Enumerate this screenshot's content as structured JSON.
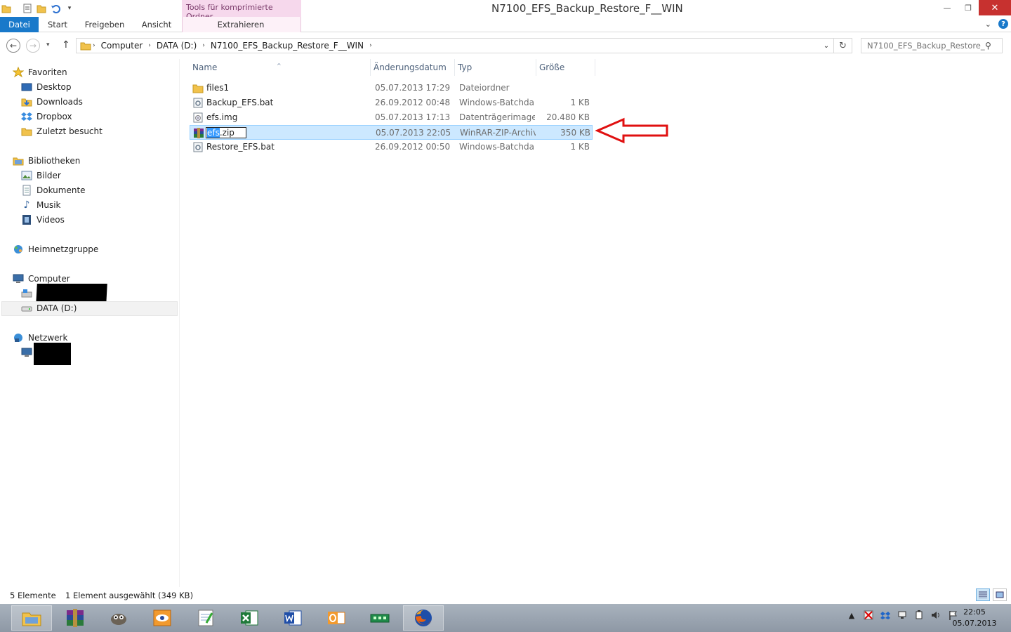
{
  "window": {
    "title": "N7100_EFS_Backup_Restore_F__WIN",
    "context_tab_header": "Tools für komprimierte Ordner",
    "controls": {
      "minimize": "—",
      "restore": "❐",
      "close": "✕"
    }
  },
  "ribbon": {
    "tabs": [
      "Datei",
      "Start",
      "Freigeben",
      "Ansicht",
      "Extrahieren"
    ]
  },
  "address": {
    "breadcrumbs": [
      "Computer",
      "DATA (D:)",
      "N7100_EFS_Backup_Restore_F__WIN"
    ],
    "search_placeholder": "N7100_EFS_Backup_Restore_F..."
  },
  "nav": {
    "favorites": {
      "label": "Favoriten",
      "items": [
        "Desktop",
        "Downloads",
        "Dropbox",
        "Zuletzt besucht"
      ]
    },
    "libraries": {
      "label": "Bibliotheken",
      "items": [
        "Bilder",
        "Dokumente",
        "Musik",
        "Videos"
      ]
    },
    "homegroup": "Heimnetzgruppe",
    "computer": {
      "label": "Computer",
      "items": [
        "DATA (D:)"
      ]
    },
    "network": "Netzwerk"
  },
  "columns": [
    "Name",
    "Änderungsdatum",
    "Typ",
    "Größe"
  ],
  "files": [
    {
      "name": "files1",
      "date": "05.07.2013 17:29",
      "type": "Dateiordner",
      "size": "",
      "icon": "folder-icon"
    },
    {
      "name": "Backup_EFS.bat",
      "date": "26.09.2012 00:48",
      "type": "Windows-Batchda...",
      "size": "1 KB",
      "icon": "batch-file-icon"
    },
    {
      "name": "efs.img",
      "date": "05.07.2013 17:13",
      "type": "Datenträgerimage...",
      "size": "20.480 KB",
      "icon": "disk-image-icon"
    },
    {
      "name": "efs.zip",
      "date": "05.07.2013 22:05",
      "type": "WinRAR-ZIP-Archiv",
      "size": "350 KB",
      "icon": "winrar-archive-icon",
      "rename_selected": "efs",
      "rename_rest": ".zip"
    },
    {
      "name": "Restore_EFS.bat",
      "date": "26.09.2012 00:50",
      "type": "Windows-Batchda...",
      "size": "1 KB",
      "icon": "batch-file-icon"
    }
  ],
  "status": {
    "count": "5 Elemente",
    "selection": "1 Element ausgewählt (349 KB)"
  },
  "taskbar": {
    "apps": [
      "explorer-icon",
      "winrar-icon",
      "gimp-icon",
      "irfanview-icon",
      "notepad-icon",
      "excel-icon",
      "word-icon",
      "outlook-icon",
      "hardware-icon",
      "firefox-icon"
    ],
    "clock_time": "22:05",
    "clock_date": "05.07.2013"
  },
  "colors": {
    "accent": "#1979ca",
    "selection": "#cce8ff",
    "annotation_arrow": "#e01010"
  }
}
